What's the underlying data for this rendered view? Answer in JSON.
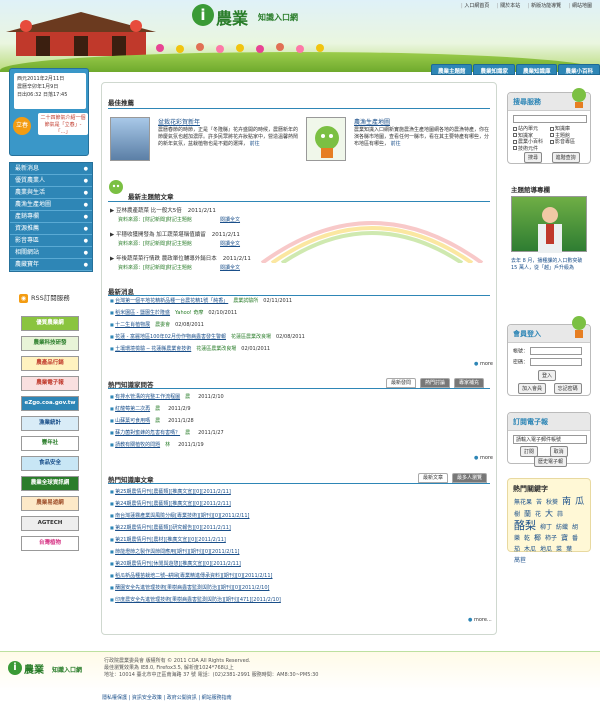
{
  "header": {
    "logo_mark": "i",
    "logo_text": "農業",
    "logo_sub": "知識入口網",
    "top_links": [
      "入口網首頁",
      "關於本站",
      "新版功能導覽",
      "網站地圖"
    ],
    "tabs": [
      "農業主題館",
      "農業知識家",
      "農業知識庫",
      "農業小百科"
    ]
  },
  "datebox": {
    "line1": "西元2011年2月11日",
    "line2": "農曆辛卯年1月9日",
    "line3": "日出06:32 日落17:45",
    "solar_badge": "立春",
    "solar_text": "二十四節氣介紹一個節氣是「立春」-「…」"
  },
  "menu": [
    "最新消息",
    "優質農業人",
    "農業與生活",
    "農漁生產地圖",
    "產銷專欄",
    "資源推薦",
    "影音專區",
    "相關網站",
    "農藏寶年"
  ],
  "rss_label": "RSS訂閱服務",
  "banners": [
    {
      "text": "優質農業網",
      "bg": "#8ac43f",
      "fg": "#fff"
    },
    {
      "text": "農業科技研發",
      "bg": "#e8f4d8",
      "fg": "#2a7d2a"
    },
    {
      "text": "農產品行銷",
      "bg": "#fff2c0",
      "fg": "#c0392b"
    },
    {
      "text": "農業電子報",
      "bg": "#f9e0e0",
      "fg": "#c0392b"
    },
    {
      "text": "eZgo.coa.gov.tw",
      "bg": "#2e86b6",
      "fg": "#fff"
    },
    {
      "text": "漁業統計",
      "bg": "#d9ecf7",
      "fg": "#1a4f8a"
    },
    {
      "text": "豐年社",
      "bg": "#fff",
      "fg": "#2a7d2a"
    },
    {
      "text": "食品安全",
      "bg": "#c8e6f5",
      "fg": "#1a4f8a"
    },
    {
      "text": "農業全球資訊網",
      "bg": "#2a7d2a",
      "fg": "#fff"
    },
    {
      "text": "農業易遊網",
      "bg": "#fde9c8",
      "fg": "#a0522d"
    },
    {
      "text": "AGTECH",
      "bg": "#eee",
      "fg": "#333"
    },
    {
      "text": "台灣植物",
      "bg": "#fff",
      "fg": "#d63384"
    }
  ],
  "recommend": {
    "title": "最佳推薦",
    "item1_title": "盆栽花彩賀新年",
    "item1_desc": "農曆春節的時節，正是『冬隆縣』花卉盛開的時候，農曆新年的節慶氣氛也越加濃厚。許多民眾將花卉妝點家中，營造溫馨熱鬧的新年氣氛，盆栽植物也是不錯的選擇，",
    "item1_more": "前往",
    "item2_title": "農漁生產地圖",
    "item2_desc": "農業知識入口網新實施農漁生產地圖網各地的農漁特產，你在演各縣市地圖，查看任何一縣市，看在其主要特產有哪些，分布地區有哪些，",
    "item2_more": "前往"
  },
  "topics": {
    "title": "最新主題館文章",
    "items": [
      {
        "title": "豆林農產蔬菜 比一般大5倍",
        "date": "2011/2/11",
        "source": "資料來源：[財記新聞]財記主題館",
        "btn": "閱讀全文"
      },
      {
        "title": "平穩收獲開發為 加工蔬菜堪稱值續留",
        "date": "2011/2/11",
        "source": "資料來源：[財記新聞]財記主題館",
        "btn": "閱讀全文"
      },
      {
        "title": "年後蔬菜菜行情跌 農政單位輔導外銷日本",
        "date": "2011/2/11",
        "source": "資料來源：[財記新聞]財記主題館",
        "btn": "閱讀全文"
      }
    ]
  },
  "news": {
    "title": "最新消息",
    "items": [
      {
        "title": "台灣第一個平地花精新品種一台農花精1號「純香」",
        "tag": "農業試驗所",
        "date": "02/11/2011"
      },
      {
        "title": "稻米園區 - 鹽園生於隆盛",
        "tag": "Yahoo! 奇摩",
        "date": "02/10/2011"
      },
      {
        "title": "十二生肖植物展",
        "tag": "農委會",
        "date": "02/08/2011"
      },
      {
        "title": "花蓮 - 富麗地區100年02月份作物病蟲害發生警報",
        "tag": "花蓮區農業改良場",
        "date": "02/08/2011"
      },
      {
        "title": "土壤環境檢驗 ─ 花蓮縣農業會技術",
        "tag": "花蓮區農業改良場",
        "date": "02/01/2011"
      }
    ],
    "more": "more"
  },
  "qa": {
    "title": "熱門知識家問答",
    "tabs": [
      "最新發問",
      "熱門討論",
      "專家補充"
    ],
    "items": [
      {
        "title": "有排水管溝的完整工作流程圖",
        "user": "農",
        "date": "2011/2/10"
      },
      {
        "title": "紅龍莓第二次再",
        "user": "農",
        "date": "2011/2/9"
      },
      {
        "title": "山蘇葉可食用嗎",
        "user": "農",
        "date": "2011/1/28"
      },
      {
        "title": "蘇力菌對蜜蜂的危害有害嗎？",
        "user": "農",
        "date": "2011/1/27"
      },
      {
        "title": "請教有關植牧的問題",
        "user": "林",
        "date": "2011/1/19"
      }
    ],
    "more": "more"
  },
  "lib": {
    "title": "熱門知識庫文章",
    "tabs": [
      "最新文章",
      "最多人瀏覽"
    ],
    "items": [
      "第25期農情月刊[農藝類][推廣文宣][0][2011/2/11]",
      "第24期農情月刊[農藝類][推廣文宣][0][2011/2/11]",
      "南台灣蓮霧產業與風險分級[專業技術][期刊][0][2011/2/11]",
      "第22期農情月刊[農藝類][研究報告][0][2011/2/11]",
      "第21期農情月刊[農材][推廣文宣][0][2011/2/11]",
      "節能燈節之製作與節間應用[期刊][期刊][0][2011/2/11]",
      "第20期農情月刊[休閒與遊憩][推廣文宣][0][2011/2/11]",
      "稻瓜新品種苗栽培二號─耕婦[專業精進傳承資料][期刊][0][2011/2/11]",
      "蘭園安全先進管理技術[果樹病蟲害監測與防治][期刊][0][2011/2/10]",
      "印度農安全先進管理技術[果樹病蟲害監測與防治][期刊][471][2011/2/10]"
    ],
    "more": "more..."
  },
  "search": {
    "title": "搜尋服務",
    "checks": [
      "站內單元",
      "知識庫",
      "知識家",
      "主題館",
      "農業小百科",
      "影音專區",
      "技術元件"
    ],
    "search_btn": "搜尋",
    "adv_btn": "進階查詢"
  },
  "leader": {
    "title": "主題館導專欄",
    "caption": "去年 8 月，播種課的入口數突破 15 萬人，從「越」戶升級為"
  },
  "login": {
    "title": "會員登入",
    "account": "帳號：",
    "password": "密碼：",
    "login_btn": "登入",
    "join_btn": "加入會員",
    "forgot_btn": "忘記密碼"
  },
  "epaper": {
    "title": "訂閱電子報",
    "placeholder": "請輸入電子郵件帳號",
    "sub_btn": "訂閱",
    "unsub_btn": "取消",
    "history_btn": "歷史電子報"
  },
  "keywords": {
    "title": "熱門關鍵字",
    "words": [
      {
        "w": "無花果",
        "s": 6
      },
      {
        "w": "苦",
        "s": 6
      },
      {
        "w": "秋葵",
        "s": 6
      },
      {
        "w": "南",
        "s": 9
      },
      {
        "w": "瓜",
        "s": 9
      },
      {
        "w": "樹",
        "s": 6
      },
      {
        "w": "蘭",
        "s": 7
      },
      {
        "w": "花",
        "s": 6
      },
      {
        "w": "大",
        "s": 8
      },
      {
        "w": "蒜",
        "s": 6
      },
      {
        "w": "酪梨",
        "s": 11
      },
      {
        "w": "柳丁",
        "s": 6
      },
      {
        "w": "紡織",
        "s": 6
      },
      {
        "w": "胡",
        "s": 6
      },
      {
        "w": "樂",
        "s": 6
      },
      {
        "w": "乾",
        "s": 6
      },
      {
        "w": "椰",
        "s": 7
      },
      {
        "w": "柿子",
        "s": 6
      },
      {
        "w": "寶",
        "s": 7
      },
      {
        "w": "番",
        "s": 6
      },
      {
        "w": "茄",
        "s": 6
      },
      {
        "w": "木瓜",
        "s": 6
      },
      {
        "w": "地瓜",
        "s": 6
      },
      {
        "w": "菜",
        "s": 6
      },
      {
        "w": "葉",
        "s": 6
      },
      {
        "w": "萵苣",
        "s": 6
      }
    ]
  },
  "footer": {
    "line1": "行政院農業委員會 版權所有 © 2011 COA All Rights Reserved.",
    "line2": "最佳瀏覽效果為 IE8.0, Firefox3.5, 解析度1024*768以上",
    "line3": "地址：10014 臺北市中正區南海路 37 號 電話：(02)2381-2991 服務時間：AM8:30~PM5:30",
    "links": [
      "隱私權保護",
      "資訊安全政策",
      "政府公開資訊",
      "網站服務指南"
    ]
  }
}
